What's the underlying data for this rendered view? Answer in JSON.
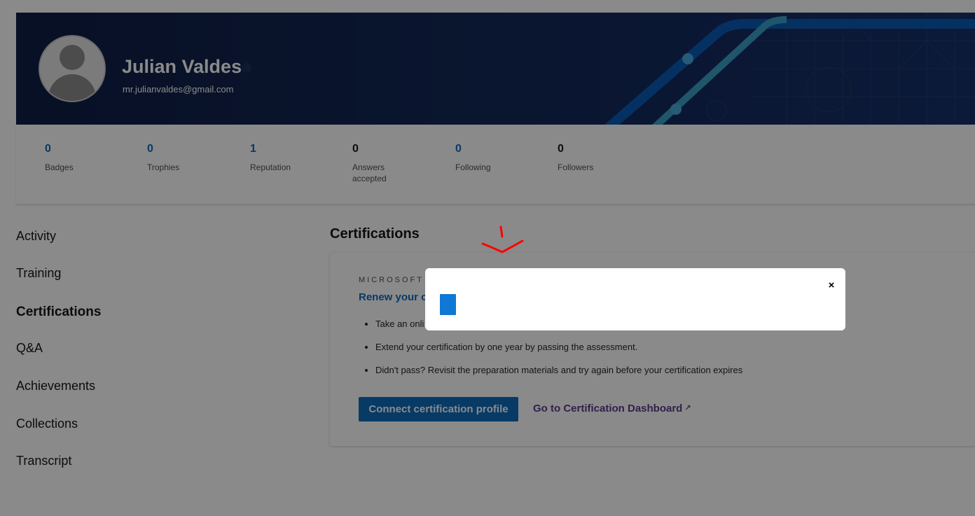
{
  "profile": {
    "name": "Julian Valdes",
    "email": "mr.julianvaldes@gmail.com"
  },
  "stats": [
    {
      "value": "0",
      "label": "Badges"
    },
    {
      "value": "0",
      "label": "Trophies"
    },
    {
      "value": "1",
      "label": "Reputation"
    },
    {
      "value": "0",
      "label": "Answers accepted"
    },
    {
      "value": "0",
      "label": "Following"
    },
    {
      "value": "0",
      "label": "Followers"
    }
  ],
  "nav": {
    "items": [
      "Activity",
      "Training",
      "Certifications",
      "Q&A",
      "Achievements",
      "Collections",
      "Transcript"
    ],
    "active": "Certifications"
  },
  "certifications": {
    "section_title": "Certifications",
    "eyebrow": "MICROSOFT",
    "card_title": "Renew your c",
    "bullets": [
      "Take an onli",
      "Extend your certification by one year by passing the assessment.",
      "Didn't pass? Revisit the preparation materials and try again before your certification expires"
    ],
    "connect_button": "Connect certification profile",
    "dashboard_link": "Go to Certification Dashboard"
  },
  "modal": {
    "close_label": "×"
  },
  "colors": {
    "accent": "#0f6cbd",
    "banner": "#0f1e45",
    "overlay": "rgba(0,0,0,0.46)",
    "annotation": "#ff0000"
  },
  "icons": {
    "close": "close-icon",
    "external_link": "external-link-icon",
    "avatar": "default-avatar-icon"
  }
}
